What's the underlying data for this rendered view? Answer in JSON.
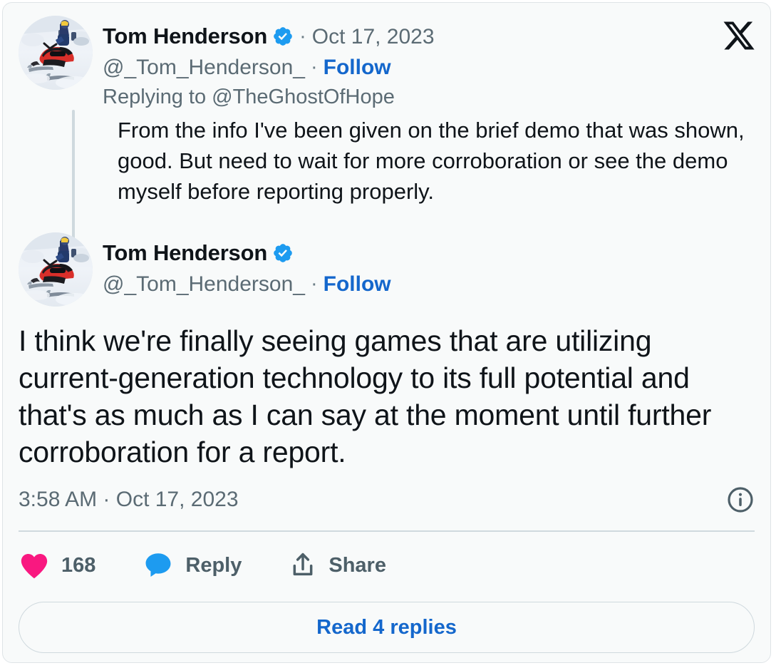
{
  "brand": {
    "logo_icon": "x-logo",
    "accent_blue": "#1d9bf0",
    "link_blue": "#1467cc",
    "like_pink": "#f91880",
    "text_primary": "#0f1419",
    "text_secondary": "#5b6b74",
    "border": "#cfd9de",
    "background": "#f8fafa"
  },
  "reply_tweet": {
    "avatar_alt": "snowmobile-photo",
    "display_name": "Tom Henderson",
    "verified": true,
    "verified_icon": "verified-badge-icon",
    "separator": "·",
    "date": "Oct 17, 2023",
    "handle": "@_Tom_Henderson_",
    "follow_label": "Follow",
    "replying_to": "Replying to @TheGhostOfHope",
    "body": "From the info I've been given on the brief demo that was shown, good. But need to wait for more corroboration or see the demo myself before reporting properly."
  },
  "main_tweet": {
    "avatar_alt": "snowmobile-photo",
    "display_name": "Tom Henderson",
    "verified": true,
    "verified_icon": "verified-badge-icon",
    "separator": "·",
    "handle": "@_Tom_Henderson_",
    "follow_label": "Follow",
    "body": "I think we're finally seeing games that are utilizing current-generation technology to its full potential and that's as much as I can say at the moment until further corroboration for a report.",
    "meta": {
      "timestamp": "3:58 AM · Oct 17, 2023",
      "info_icon": "info-circle-icon"
    },
    "actions": [
      {
        "icon": "heart-icon",
        "label": "168"
      },
      {
        "icon": "reply-bubble-icon",
        "label": "Reply"
      },
      {
        "icon": "share-icon",
        "label": "Share"
      }
    ],
    "read_replies_label": "Read 4 replies"
  }
}
